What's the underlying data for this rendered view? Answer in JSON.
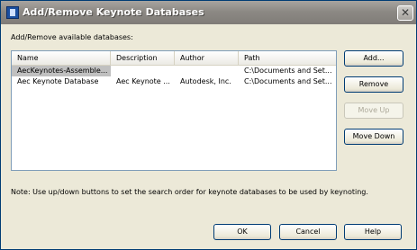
{
  "window": {
    "title": "Add/Remove Keynote Databases",
    "close_glyph": "✕"
  },
  "section_label": "Add/Remove available databases:",
  "columns": [
    "Name",
    "Description",
    "Author",
    "Path"
  ],
  "rows": [
    {
      "name": "AecKeynotes-Assemble...",
      "description": "",
      "author": "",
      "path": "C:\\Documents and Set..."
    },
    {
      "name": "Aec Keynote Database",
      "description": "Aec Keynote ...",
      "author": "Autodesk, Inc.",
      "path": "C:\\Documents and Set..."
    }
  ],
  "side_buttons": {
    "add": "Add...",
    "remove": "Remove",
    "move_up": "Move Up",
    "move_down": "Move Down"
  },
  "note": "Note: Use up/down buttons to set the search order for keynote databases to be used by keynoting.",
  "footer_buttons": {
    "ok": "OK",
    "cancel": "Cancel",
    "help": "Help"
  },
  "icons": {
    "app": "keynote-app-icon",
    "close": "close-icon"
  }
}
